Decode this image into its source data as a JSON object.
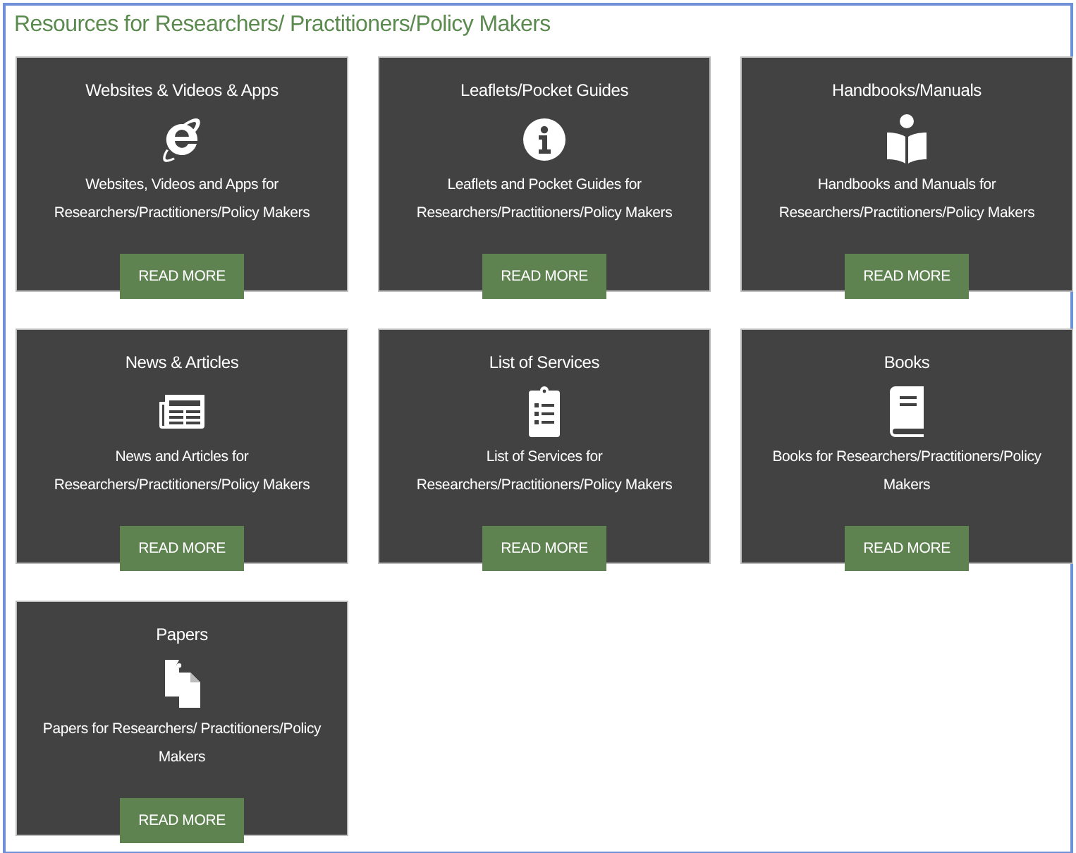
{
  "heading": "Resources for Researchers/ Practitioners/Policy Makers",
  "cards": [
    {
      "title": "Websites & Videos & Apps",
      "kind": "browser",
      "description": "Websites, Videos and Apps for Researchers/Practitioners/Policy Makers",
      "button": "READ MORE"
    },
    {
      "title": "Leaflets/Pocket Guides",
      "kind": "info",
      "description": "Leaflets and Pocket Guides for Researchers/Practitioners/Policy Makers",
      "button": "READ MORE"
    },
    {
      "title": "Handbooks/Manuals",
      "kind": "reader",
      "description": "Handbooks and Manuals for Researchers/Practitioners/Policy Makers",
      "button": "READ MORE"
    },
    {
      "title": "News & Articles",
      "kind": "newspaper",
      "description": "News and Articles for Researchers/Practitioners/Policy Makers",
      "button": "READ MORE"
    },
    {
      "title": "List of Services",
      "kind": "clipboard",
      "description": "List of Services for Researchers/Practitioners/Policy Makers",
      "button": "READ MORE"
    },
    {
      "title": "Books",
      "kind": "book",
      "description": "Books for Researchers/Practitioners/Policy Makers",
      "button": "READ MORE"
    },
    {
      "title": "Papers",
      "kind": "copy",
      "description": "Papers for Researchers/ Practitioners/Policy Makers",
      "button": "READ MORE"
    }
  ]
}
